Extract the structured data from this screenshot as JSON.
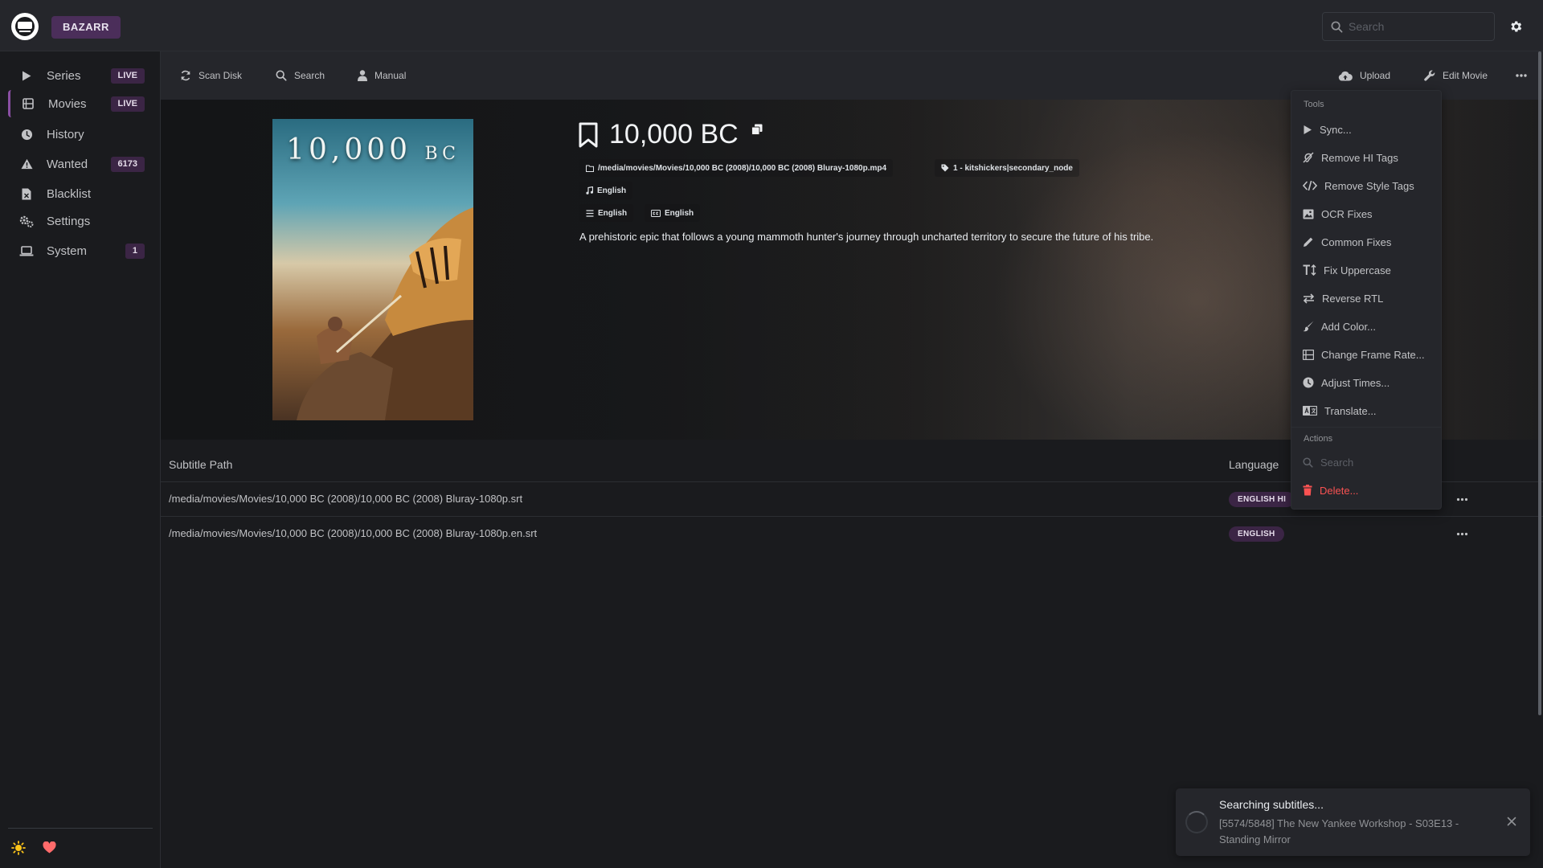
{
  "app": {
    "brand": "BAZARR"
  },
  "header": {
    "search_placeholder": "Search"
  },
  "sidebar": {
    "items": [
      {
        "label": "Series",
        "badge": "LIVE",
        "icon": "play-icon"
      },
      {
        "label": "Movies",
        "badge": "LIVE",
        "icon": "film-icon",
        "active": true
      },
      {
        "label": "History",
        "badge": "",
        "icon": "clock-icon"
      },
      {
        "label": "Wanted",
        "badge": "6173",
        "icon": "warning-icon"
      },
      {
        "label": "Blacklist",
        "badge": "",
        "icon": "file-x-icon"
      },
      {
        "label": "Settings",
        "badge": "",
        "icon": "cogs-icon"
      },
      {
        "label": "System",
        "badge": "1",
        "icon": "laptop-icon"
      }
    ]
  },
  "toolbar": {
    "scan_disk": "Scan Disk",
    "search": "Search",
    "manual": "Manual",
    "upload": "Upload",
    "edit_movie": "Edit Movie"
  },
  "movie": {
    "title": "10,000 BC",
    "poster_title": "10,000",
    "poster_suffix": "BC",
    "path": "/media/movies/Movies/10,000 BC (2008)/10,000 BC (2008) Bluray-1080p.mp4",
    "tags": "1 - kitshickers|secondary_node",
    "audio_language": "English",
    "profile_language": "English",
    "subtitle_language": "English",
    "overview": "A prehistoric epic that follows a young mammoth hunter's journey through uncharted territory to secure the future of his tribe."
  },
  "table": {
    "headers": {
      "path": "Subtitle Path",
      "language": "Language"
    },
    "rows": [
      {
        "path": "/media/movies/Movies/10,000 BC (2008)/10,000 BC (2008) Bluray-1080p.srt",
        "language": "ENGLISH HI"
      },
      {
        "path": "/media/movies/Movies/10,000 BC (2008)/10,000 BC (2008) Bluray-1080p.en.srt",
        "language": "ENGLISH"
      }
    ]
  },
  "menu": {
    "tools_label": "Tools",
    "tools": [
      "Sync...",
      "Remove HI Tags",
      "Remove Style Tags",
      "OCR Fixes",
      "Common Fixes",
      "Fix Uppercase",
      "Reverse RTL",
      "Add Color...",
      "Change Frame Rate...",
      "Adjust Times...",
      "Translate..."
    ],
    "actions_label": "Actions",
    "actions": {
      "search": "Search",
      "delete": "Delete..."
    }
  },
  "notification": {
    "title": "Searching subtitles...",
    "message": "[5574/5848] The New Yankee Workshop - S03E13 - Standing Mirror"
  },
  "colors": {
    "accent": "#8a4fa3",
    "badge_bg": "#3b2545",
    "danger": "#fa5252",
    "sun": "#fcc419",
    "heart": "#ff6b6b"
  }
}
